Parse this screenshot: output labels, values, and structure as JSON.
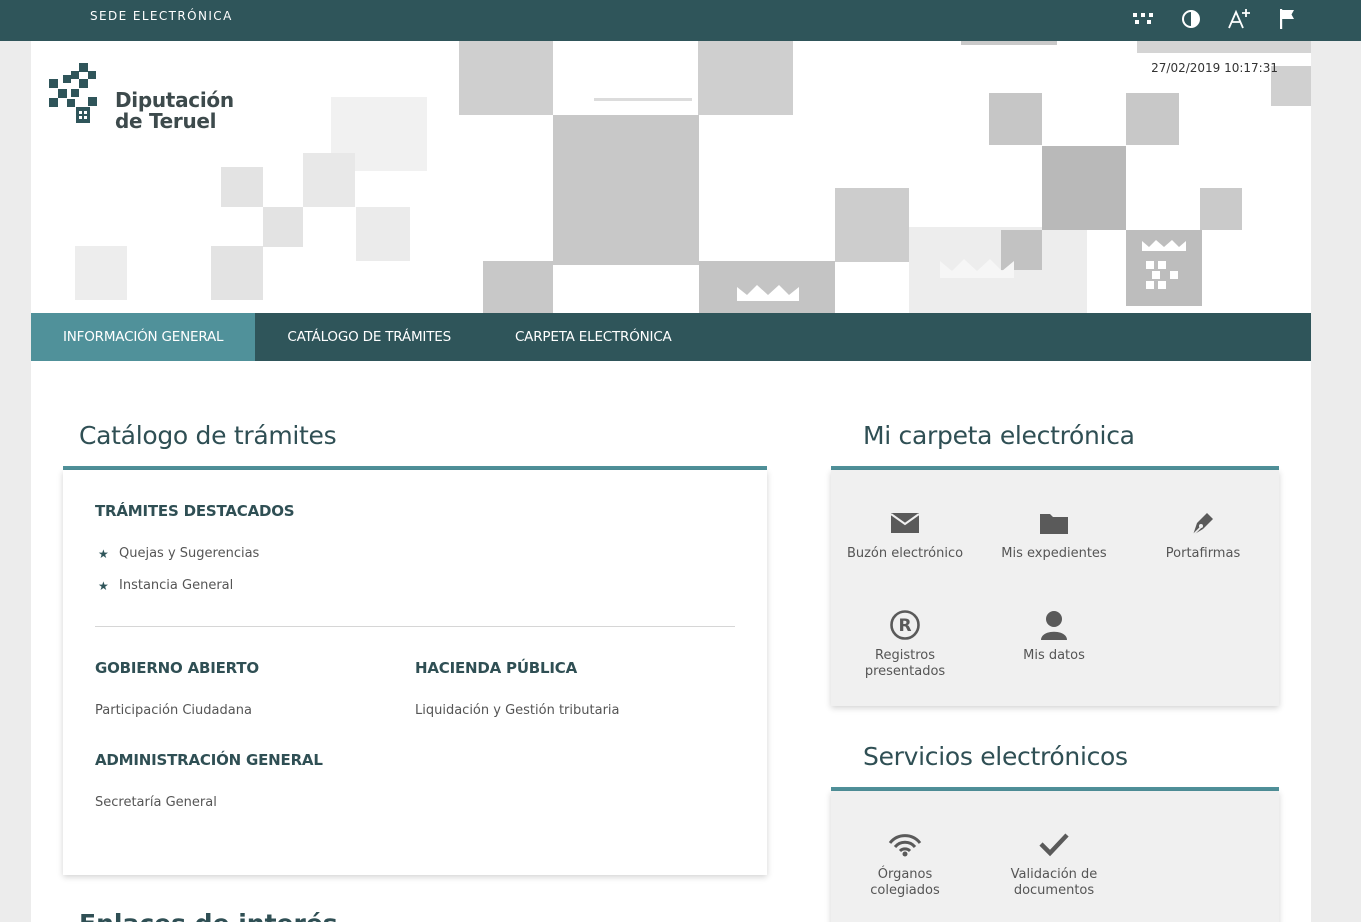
{
  "topbar": {
    "title": "SEDE ELECTRÓNICA",
    "tools": [
      "sitemap-icon",
      "contrast-icon",
      "font-size-increase-icon",
      "language-flag-icon"
    ],
    "color": "#2f555a"
  },
  "header": {
    "logo_line1": "Diputación",
    "logo_line2": "de Teruel",
    "datetime": "27/02/2019 10:17:31"
  },
  "nav": {
    "items": [
      {
        "label": "INFORMACIÓN GENERAL",
        "active": true
      },
      {
        "label": "CATÁLOGO DE TRÁMITES",
        "active": false
      },
      {
        "label": "CARPETA ELECTRÓNICA",
        "active": false
      }
    ],
    "accent": "#50919a"
  },
  "catalogo": {
    "title": "Catálogo de trámites",
    "destacados": {
      "heading": "TRÁMITES DESTACADOS",
      "items": [
        "Quejas y Sugerencias",
        "Instancia General"
      ]
    },
    "categories": [
      {
        "heading": "GOBIERNO ABIERTO",
        "items": [
          "Participación Ciudadana"
        ]
      },
      {
        "heading": "HACIENDA PÚBLICA",
        "items": [
          "Liquidación y Gestión tributaria"
        ]
      },
      {
        "heading": "ADMINISTRACIÓN GENERAL",
        "items": [
          "Secretaría General"
        ]
      }
    ]
  },
  "carpeta": {
    "title": "Mi carpeta electrónica",
    "tiles": [
      {
        "label": "Buzón electrónico",
        "icon": "envelope-icon"
      },
      {
        "label": "Mis expedientes",
        "icon": "folder-icon"
      },
      {
        "label": "Portafirmas",
        "icon": "pen-nib-icon"
      },
      {
        "label": "Registros presentados",
        "icon": "registered-icon"
      },
      {
        "label": "Mis datos",
        "icon": "user-icon"
      }
    ]
  },
  "servicios": {
    "title": "Servicios electrónicos",
    "tiles": [
      {
        "label": "Órganos colegiados",
        "icon": "signal-icon"
      },
      {
        "label": "Validación de documentos",
        "icon": "checkmark-icon"
      }
    ]
  },
  "enlaces": {
    "title": "Enlaces de interés"
  }
}
